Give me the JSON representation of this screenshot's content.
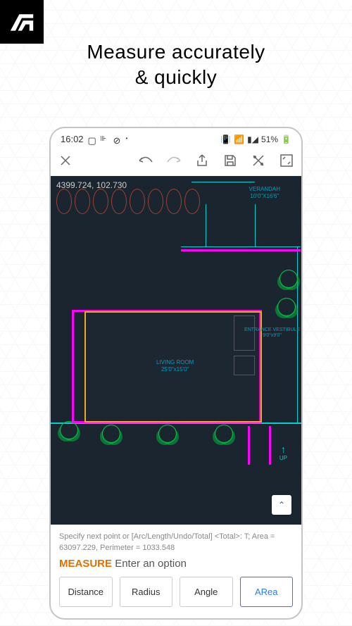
{
  "headline": {
    "line1": "Measure accurately",
    "line2": "& quickly"
  },
  "statusbar": {
    "time": "16:02",
    "battery": "51%"
  },
  "toolbar": {
    "close": "close",
    "undo": "undo",
    "redo": "redo",
    "share": "share",
    "save": "save",
    "shuffle": "crosshair",
    "fullscreen": "fullscreen"
  },
  "canvas": {
    "coords": "4399.724, 102.730",
    "verandah": {
      "name": "VERANDAH",
      "dim": "10'0\"X16'6\""
    },
    "living": {
      "name": "LIVING ROOM",
      "dim": "25'0\"x15'0\""
    },
    "entrance": {
      "name": "ENTRANCE VESTIBULE",
      "dim": "9'0\"x9'0\""
    },
    "up": "UP"
  },
  "expand_glyph": "⌃",
  "cmdline": "Specify next point or [Arc/Length/Undo/Total] <Total>: T; Area = 63097.229, Perimeter = 1033.548",
  "measure": {
    "keyword": "MEASURE",
    "prompt": "Enter an option"
  },
  "options": {
    "distance": "Distance",
    "radius": "Radius",
    "angle": "Angle",
    "area": "ARea"
  }
}
